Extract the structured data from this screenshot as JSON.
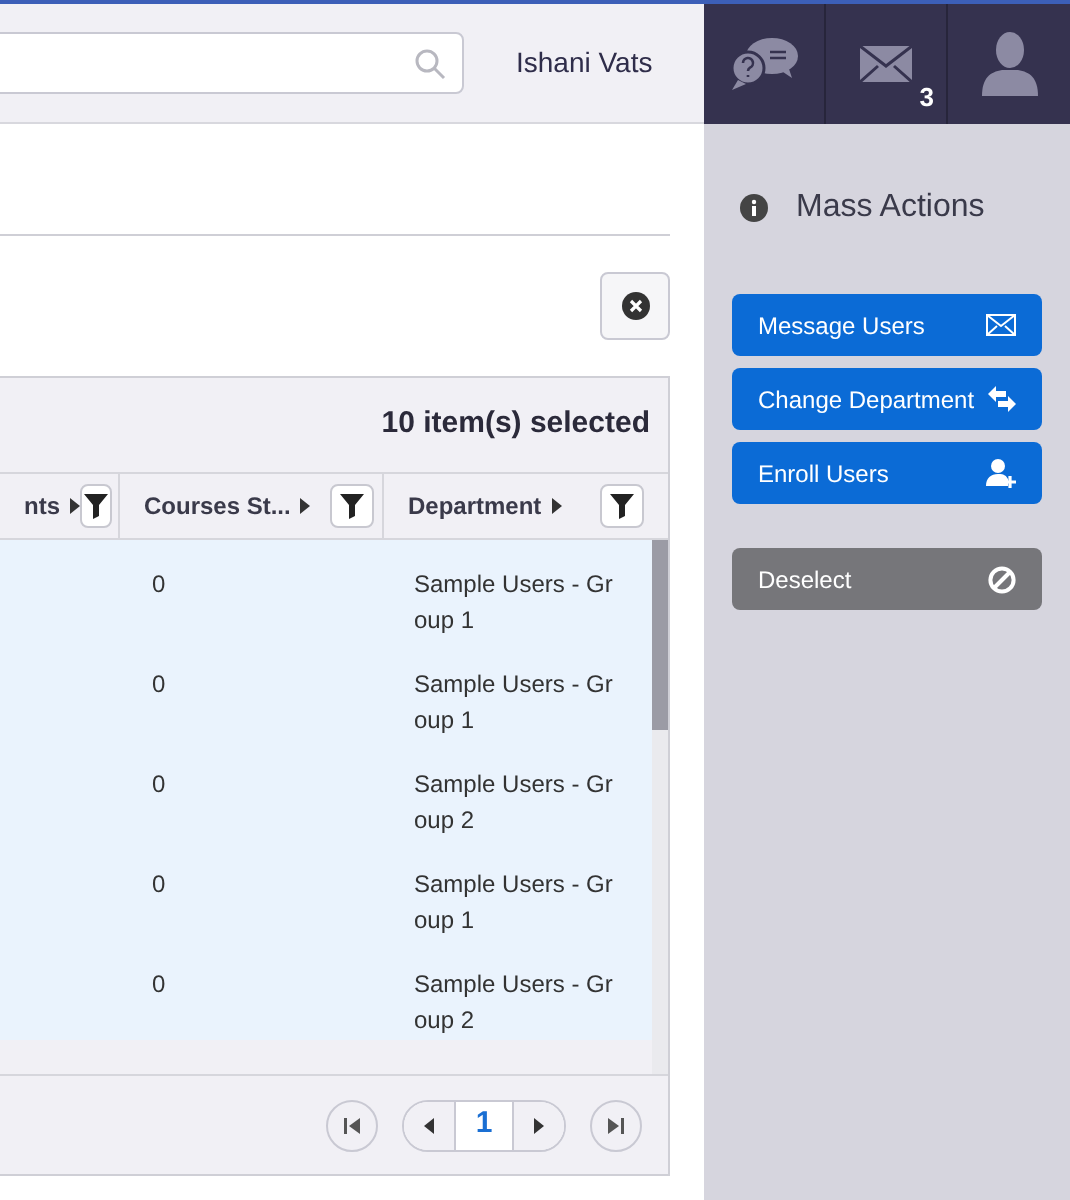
{
  "header": {
    "user_name": "Ishani Vats",
    "messages_count": "3"
  },
  "table": {
    "selection_text": "10 item(s) selected",
    "columns": [
      {
        "label": "nts"
      },
      {
        "label": "Courses St..."
      },
      {
        "label": "Department"
      }
    ],
    "rows": [
      {
        "courses": "0",
        "department": "Sample Users - Group 1",
        "selected": true
      },
      {
        "courses": "0",
        "department": "Sample Users - Group 1",
        "selected": true
      },
      {
        "courses": "0",
        "department": "Sample Users - Group 2",
        "selected": true
      },
      {
        "courses": "0",
        "department": "Sample Users - Group 1",
        "selected": true
      },
      {
        "courses": "0",
        "department": "Sample Users - Group 2",
        "selected": true
      }
    ],
    "pagination": {
      "page": "1"
    }
  },
  "mass_actions": {
    "title": "Mass Actions",
    "actions": [
      {
        "label": "Message Users",
        "kind": "message"
      },
      {
        "label": "Change Department",
        "kind": "transfer"
      },
      {
        "label": "Enroll Users",
        "kind": "enroll"
      },
      {
        "label": "Deselect",
        "kind": "deselect"
      }
    ]
  }
}
